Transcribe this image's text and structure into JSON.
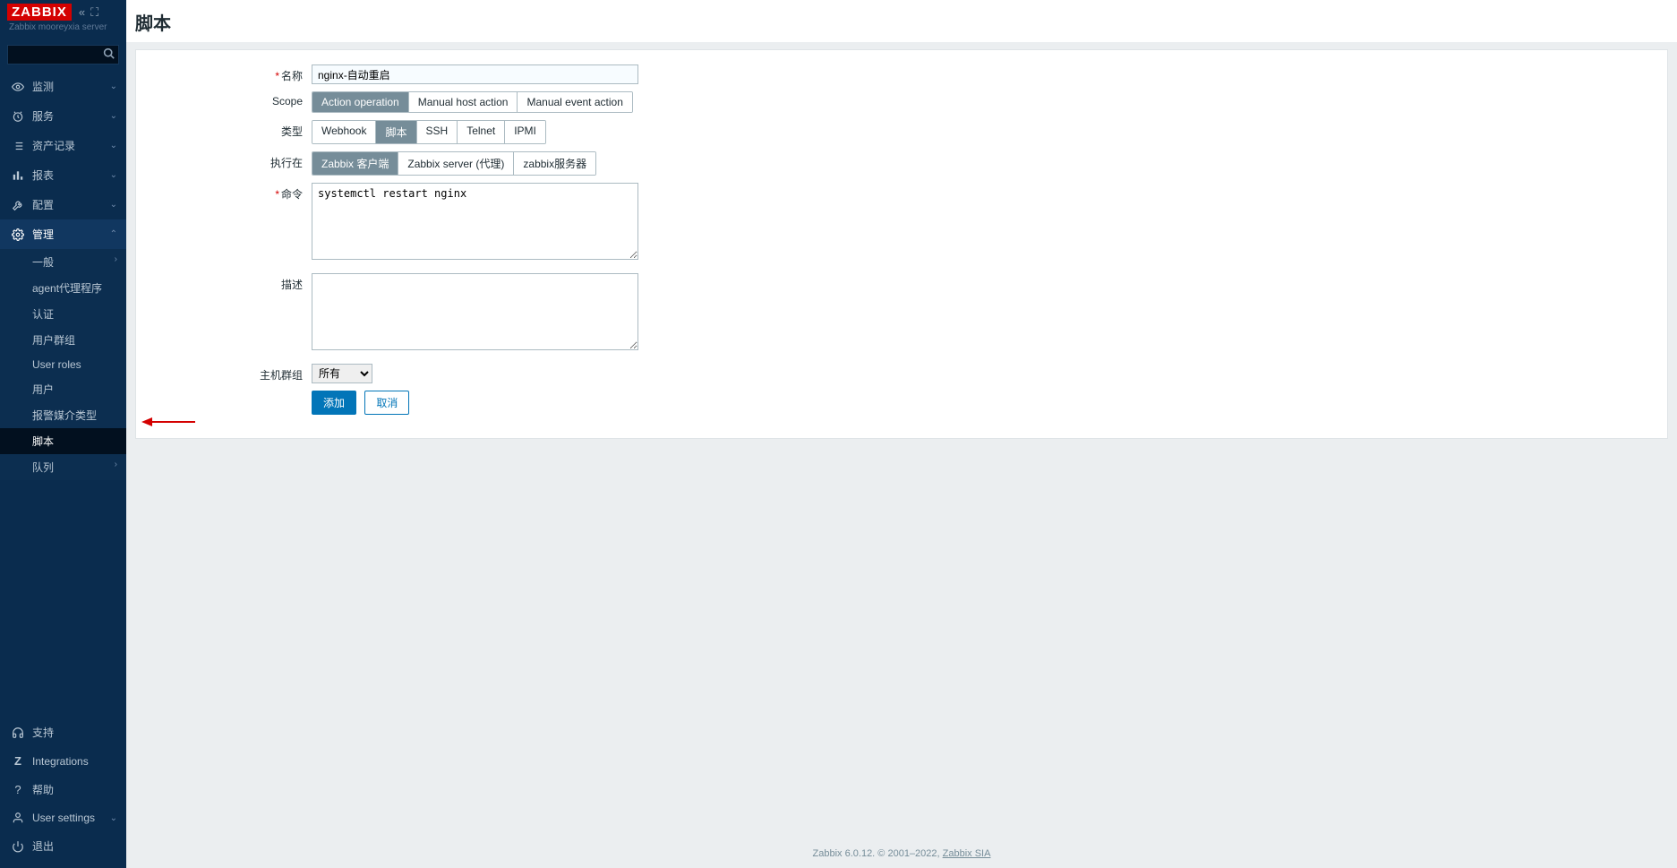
{
  "app": {
    "logo": "ZABBIX",
    "server_name": "Zabbix mooreyxia server"
  },
  "sidebar": {
    "nav": [
      {
        "icon": "eye",
        "label": "监测",
        "expandable": true
      },
      {
        "icon": "clock",
        "label": "服务",
        "expandable": true
      },
      {
        "icon": "list",
        "label": "资产记录",
        "expandable": true
      },
      {
        "icon": "bar",
        "label": "报表",
        "expandable": true
      },
      {
        "icon": "wrench",
        "label": "配置",
        "expandable": true
      },
      {
        "icon": "gear",
        "label": "管理",
        "expandable": true,
        "expanded": true
      }
    ],
    "admin_sub": [
      {
        "label": "一般",
        "chevron": true
      },
      {
        "label": "agent代理程序"
      },
      {
        "label": "认证"
      },
      {
        "label": "用户群组"
      },
      {
        "label": "User roles"
      },
      {
        "label": "用户"
      },
      {
        "label": "报警媒介类型"
      },
      {
        "label": "脚本",
        "active": true
      },
      {
        "label": "队列",
        "chevron": true
      }
    ],
    "bottom": [
      {
        "icon": "support",
        "label": "支持"
      },
      {
        "icon": "z",
        "label": "Integrations"
      },
      {
        "icon": "help",
        "label": "帮助"
      },
      {
        "icon": "user",
        "label": "User settings",
        "expandable": true
      },
      {
        "icon": "power",
        "label": "退出"
      }
    ]
  },
  "page": {
    "title": "脚本"
  },
  "form": {
    "name": {
      "label": "名称",
      "value": "nginx-自动重启"
    },
    "scope": {
      "label": "Scope",
      "options": [
        "Action operation",
        "Manual host action",
        "Manual event action"
      ],
      "active": 0
    },
    "type": {
      "label": "类型",
      "options": [
        "Webhook",
        "脚本",
        "SSH",
        "Telnet",
        "IPMI"
      ],
      "active": 1
    },
    "execute_on": {
      "label": "执行在",
      "options": [
        "Zabbix 客户端",
        "Zabbix server (代理)",
        "zabbix服务器"
      ],
      "active": 0
    },
    "commands": {
      "label": "命令",
      "value": "systemctl restart nginx"
    },
    "description": {
      "label": "描述",
      "value": ""
    },
    "host_group": {
      "label": "主机群组",
      "value": "所有",
      "options": [
        "所有"
      ]
    },
    "buttons": {
      "add": "添加",
      "cancel": "取消"
    }
  },
  "footer": {
    "text": "Zabbix 6.0.12. © 2001–2022, ",
    "link": "Zabbix SIA"
  }
}
